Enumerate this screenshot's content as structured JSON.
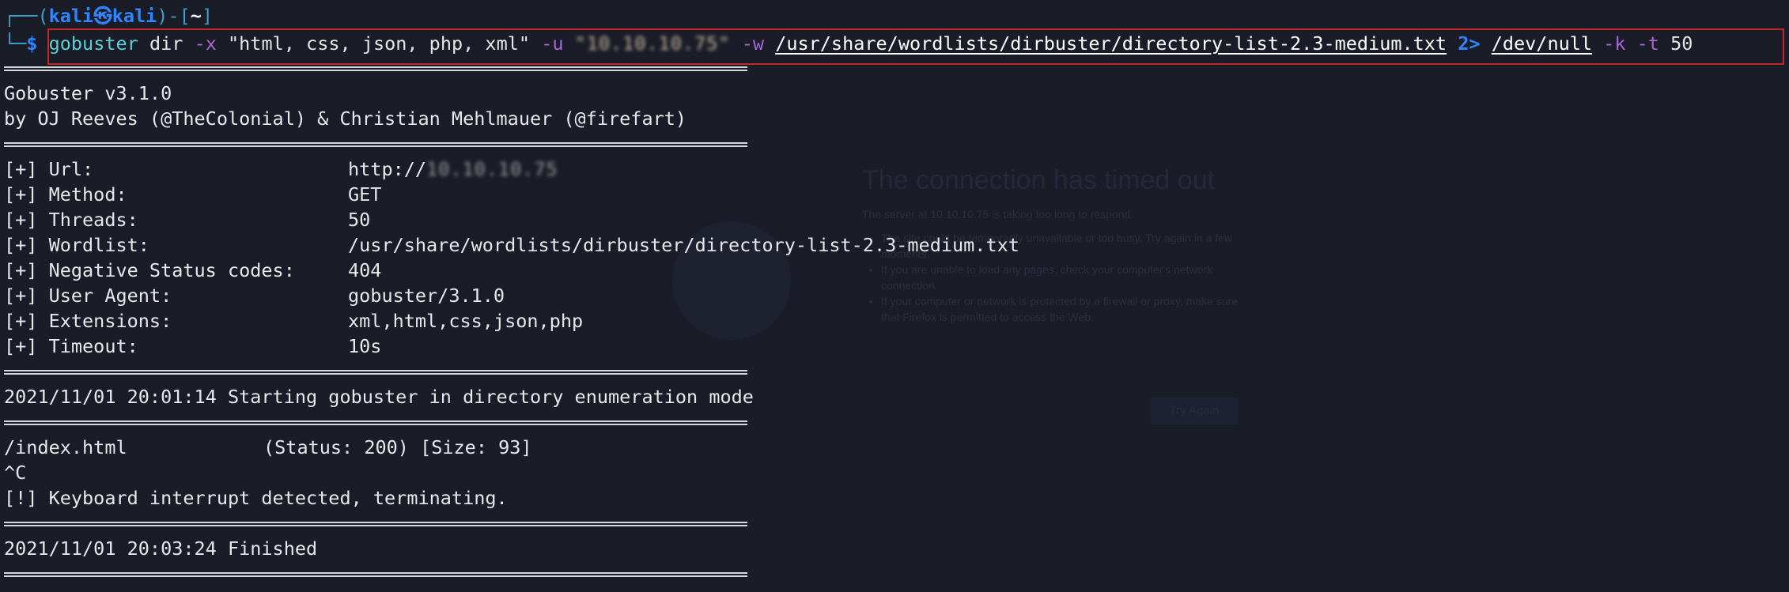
{
  "prompt": {
    "frame_top": "┌──(",
    "user": "kali",
    "at_symbol": "㉿",
    "host": "kali",
    "frame_mid": ")-[",
    "dir": "~",
    "frame_end": "]",
    "frame_bottom": "└─",
    "dollar": "$"
  },
  "command": {
    "name": "gobuster",
    "sub": "dir",
    "flag_x": "-x",
    "ext_str": "\"html, css, json, php, xml\"",
    "flag_u": "-u",
    "target_redacted": "\"10.10.10.75\"",
    "flag_w": "-w",
    "wordlist": "/usr/share/wordlists/dirbuster/directory-list-2.3-medium.txt",
    "redirect": "2>",
    "devnull": "/dev/null",
    "flag_k": "-k",
    "flag_t": "-t",
    "threads": "50"
  },
  "banner": {
    "version": "Gobuster v3.1.0",
    "authors": "by OJ Reeves (@TheColonial) & Christian Mehlmauer (@firefart)"
  },
  "config": [
    {
      "label": "[+] Url:",
      "value_prefix": "http://",
      "value_redacted": "10.10.10.75"
    },
    {
      "label": "[+] Method:",
      "value": "GET"
    },
    {
      "label": "[+] Threads:",
      "value": "50"
    },
    {
      "label": "[+] Wordlist:",
      "value": "/usr/share/wordlists/dirbuster/directory-list-2.3-medium.txt"
    },
    {
      "label": "[+] Negative Status codes:",
      "value": "404"
    },
    {
      "label": "[+] User Agent:",
      "value": "gobuster/3.1.0"
    },
    {
      "label": "[+] Extensions:",
      "value": "xml,html,css,json,php"
    },
    {
      "label": "[+] Timeout:",
      "value": "10s"
    }
  ],
  "start_line": "2021/11/01 20:01:14 Starting gobuster in directory enumeration mode",
  "results": {
    "path": "/index.html",
    "status": "(Status: 200) [Size: 93]",
    "ctrl_c": "^C",
    "interrupt": "[!] Keyboard interrupt detected, terminating."
  },
  "finished_line": "2021/11/01 20:03:24 Finished",
  "ghost": {
    "title": "The connection has timed out",
    "desc": "The server at 10.10.10.75 is taking too long to respond.",
    "bullets": [
      "The site could be temporarily unavailable or too busy. Try again in a few moments.",
      "If you are unable to load any pages, check your computer's network connection.",
      "If your computer or network is protected by a firewall or proxy, make sure that Firefox is permitted to access the Web."
    ],
    "button": "Try Again"
  },
  "colors": {
    "background": "#1a1d28",
    "prompt_blue": "#2f86ff",
    "command_cyan": "#5ccfd6",
    "flag_purple": "#a667d6",
    "highlight_box": "#c0282a"
  }
}
